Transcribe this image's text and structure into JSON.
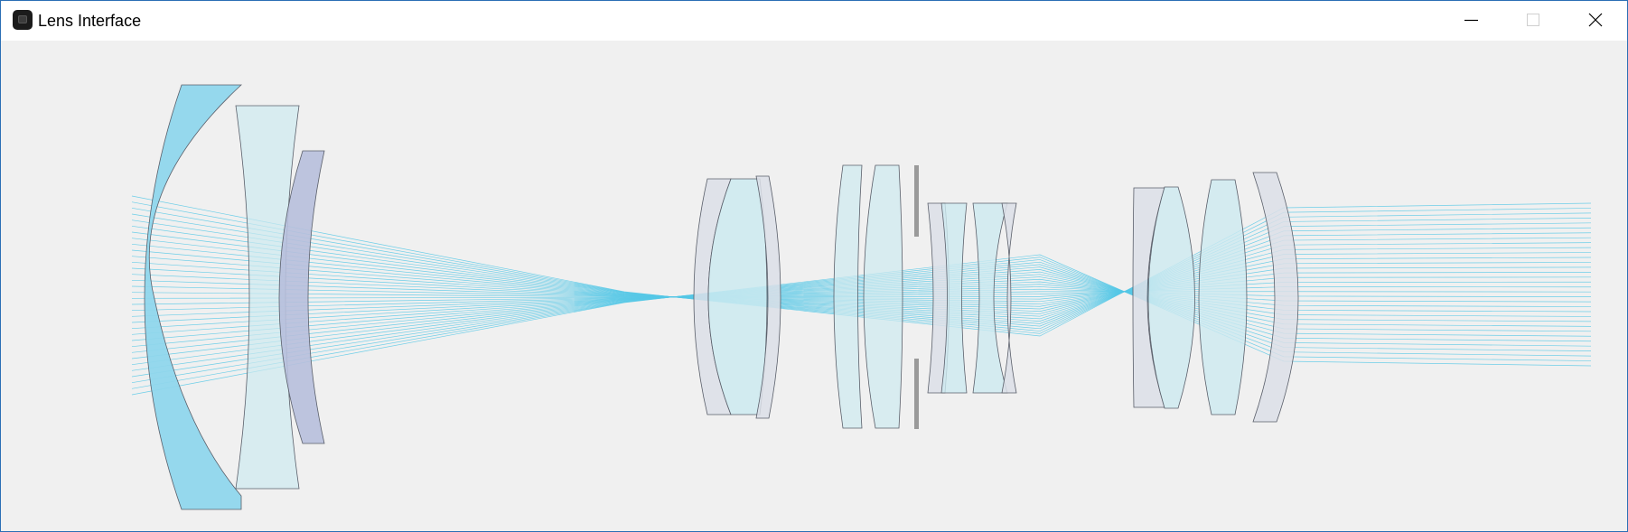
{
  "window": {
    "title": "Lens Interface",
    "app_icon": "lens-app-icon",
    "controls": {
      "minimize_icon": "minimize-icon",
      "maximize_icon": "maximize-icon",
      "close_icon": "close-icon"
    }
  },
  "colors": {
    "titlebar_background": "#ffffff",
    "canvas_background": "#f0f0f0",
    "window_border": "#2b6fb5",
    "ray_color": "#56c8e6",
    "lens_outline": "#5a5f6a",
    "lens_fill_cyan": "#8fd6ec",
    "lens_fill_light_cyan": "#cdeaf0",
    "lens_fill_gray": "#dcdfe8",
    "lens_fill_blue_gray": "#b7bfdc",
    "aperture_stop": "#9a9a9a"
  }
}
